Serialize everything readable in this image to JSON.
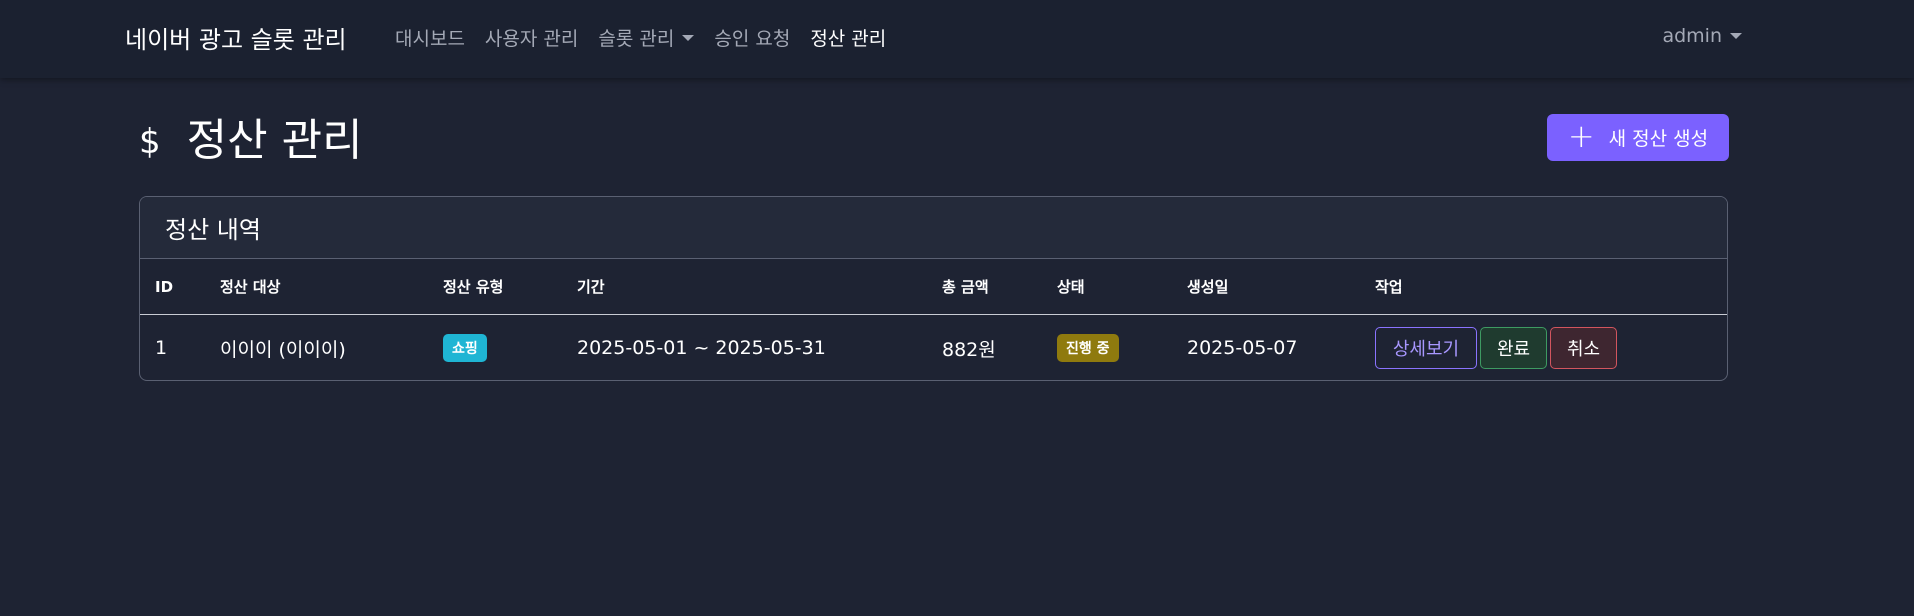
{
  "navbar": {
    "brand": "네이버 광고 슬롯 관리",
    "links": [
      {
        "label": "대시보드"
      },
      {
        "label": "사용자 관리"
      },
      {
        "label": "슬롯 관리"
      },
      {
        "label": "승인 요청"
      },
      {
        "label": "정산 관리"
      }
    ],
    "user": "admin"
  },
  "page": {
    "icon": "$",
    "title": "정산 관리",
    "new_button": "새 정산 생성"
  },
  "card": {
    "title": "정산 내역",
    "columns": [
      "ID",
      "정산 대상",
      "정산 유형",
      "기간",
      "총 금액",
      "상태",
      "생성일",
      "작업"
    ],
    "rows": [
      {
        "id": "1",
        "target": "이이이 (이이이)",
        "type": "쇼핑",
        "period": "2025-05-01 ~ 2025-05-31",
        "amount": "882원",
        "status": "진행 중",
        "created": "2025-05-07",
        "actions": {
          "detail": "상세보기",
          "done": "완료",
          "cancel": "취소"
        }
      }
    ]
  },
  "colors": {
    "background": "#1e2333",
    "navbar": "#1b2130",
    "accent": "#7b61ff",
    "badge_shop": "#1fb5d4",
    "badge_progress": "#8f7a0e"
  }
}
